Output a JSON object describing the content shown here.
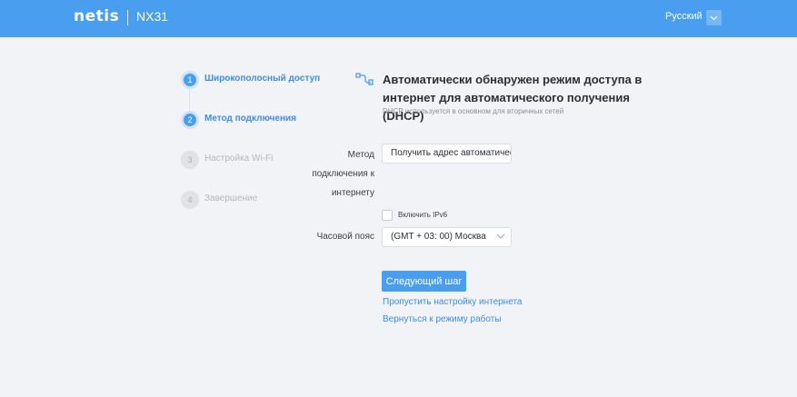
{
  "header": {
    "brand": "netis",
    "model": "NX31",
    "language": "Русский"
  },
  "steps": [
    {
      "number": "1",
      "label": "Широкополосный доступ",
      "state": "active"
    },
    {
      "number": "2",
      "label": "Метод подключения",
      "state": "active"
    },
    {
      "number": "3",
      "label": "Настройка Wi-Fi",
      "state": "inactive"
    },
    {
      "number": "4",
      "label": "Завершение",
      "state": "inactive"
    }
  ],
  "main": {
    "title": "Автоматически обнаружен режим доступа в интернет для автоматического получения (DHCP)",
    "subtitle": "DHCP используется в основном для вторичных сетей",
    "connection_method": {
      "label": "Метод подключения к интернету",
      "value": "Получить адрес автоматически"
    },
    "ipv6": {
      "label": "Включить IPv6",
      "checked": false
    },
    "timezone": {
      "label": "Часовой пояс",
      "value": "(GMT + 03: 00) Москва"
    },
    "next_button": "Следующий шаг",
    "skip_link": "Пропустить настройку интернета",
    "back_link": "Вернуться к режиму работы"
  },
  "colors": {
    "accent": "#4a9ef0",
    "background": "#f2f3f7"
  },
  "icons": {
    "title": "network-cable-icon",
    "language_dropdown": "chevron-down-icon",
    "timezone_dropdown": "chevron-down-icon"
  }
}
